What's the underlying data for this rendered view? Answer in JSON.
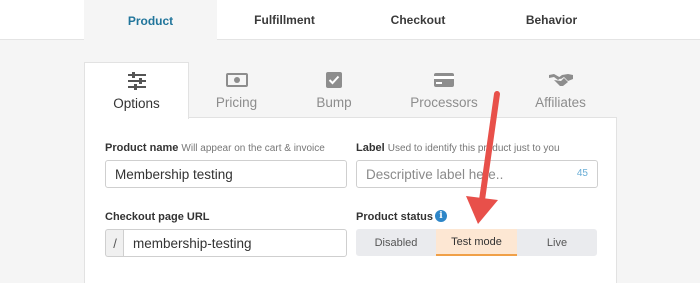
{
  "top_tabs": [
    "Product",
    "Fulfillment",
    "Checkout",
    "Behavior"
  ],
  "sub_tabs": [
    {
      "label": "Options",
      "icon": "sliders-icon"
    },
    {
      "label": "Pricing",
      "icon": "money-icon"
    },
    {
      "label": "Bump",
      "icon": "checkbox-icon"
    },
    {
      "label": "Processors",
      "icon": "credit-card-icon"
    },
    {
      "label": "Affiliates",
      "icon": "handshake-icon"
    }
  ],
  "form": {
    "product_name": {
      "label": "Product name",
      "help": "Will appear on the cart & invoice",
      "value": "Membership testing"
    },
    "label_field": {
      "label": "Label",
      "help": "Used to identify this product just to you",
      "placeholder": "Descriptive label here..",
      "count": "45"
    },
    "checkout_url": {
      "label": "Checkout page URL",
      "prefix": "/",
      "value": "membership-testing"
    },
    "product_status": {
      "label": "Product status",
      "info_icon": "i",
      "options": [
        "Disabled",
        "Test mode",
        "Live"
      ],
      "selected": "Test mode"
    }
  },
  "colors": {
    "active_top_tab": "#21759b",
    "status_active_bg": "#fde7d3",
    "status_active_border": "#f0a048",
    "annotation_arrow": "#e8504a",
    "info_icon": "#2e86c8"
  }
}
